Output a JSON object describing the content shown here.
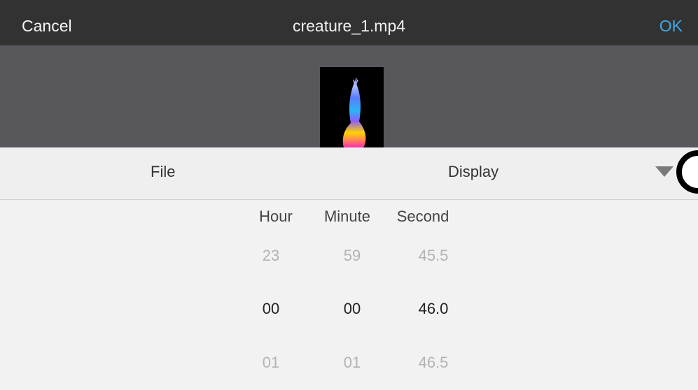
{
  "header": {
    "cancel_label": "Cancel",
    "title": "creature_1.mp4",
    "ok_label": "OK",
    "ok_color": "#3fa9e8"
  },
  "tabs": {
    "file_label": "File",
    "display_label": "Display"
  },
  "picker": {
    "columns": [
      "Hour",
      "Minute",
      "Second"
    ],
    "rows": [
      {
        "hour": "23",
        "minute": "59",
        "second": "45.5"
      },
      {
        "hour": "00",
        "minute": "00",
        "second": "46.0"
      },
      {
        "hour": "01",
        "minute": "01",
        "second": "46.5"
      }
    ],
    "selected_row": 1
  },
  "icons": {
    "dropdown": "triangle-down-icon",
    "dial": "dial-icon"
  }
}
